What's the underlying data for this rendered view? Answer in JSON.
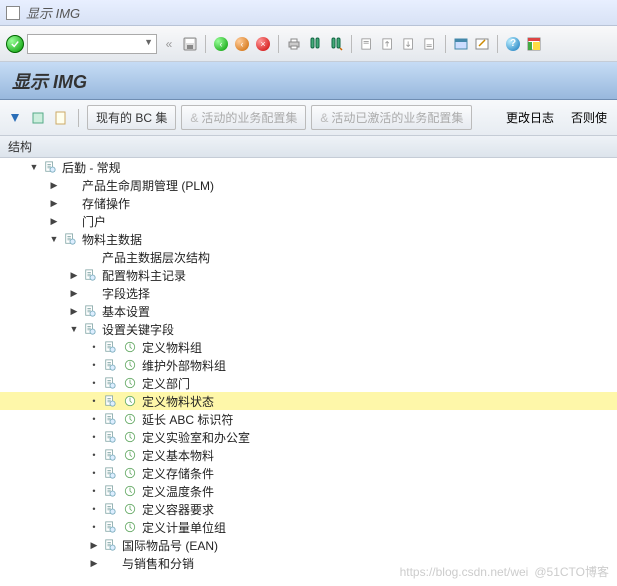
{
  "menu_title": "显示 IMG",
  "page_title": "显示 IMG",
  "tree_header": "结构",
  "watermark_left": "https://blog.csdn.net/wei",
  "watermark_right": "@51CTO博客",
  "toolbar2": {
    "existing_bc": "现有的 BC 集",
    "active_config": "活动的业务配置集",
    "activated_config": "活动已激活的业务配置集",
    "change_log": "更改日志",
    "other_use": "否则使"
  },
  "tree": [
    {
      "indent": 0,
      "toggle": "open",
      "icons": [
        "doc"
      ],
      "label": "后勤 - 常规"
    },
    {
      "indent": 1,
      "toggle": "closed",
      "icons": [],
      "label": "产品生命周期管理 (PLM)"
    },
    {
      "indent": 1,
      "toggle": "closed",
      "icons": [],
      "label": "存储操作"
    },
    {
      "indent": 1,
      "toggle": "closed",
      "icons": [],
      "label": "门户"
    },
    {
      "indent": 1,
      "toggle": "open",
      "icons": [
        "doc"
      ],
      "label": "物料主数据"
    },
    {
      "indent": 2,
      "toggle": "none",
      "icons": [],
      "label": "产品主数据层次结构"
    },
    {
      "indent": 2,
      "toggle": "closed",
      "icons": [
        "doc"
      ],
      "label": "配置物料主记录"
    },
    {
      "indent": 2,
      "toggle": "closed",
      "icons": [],
      "label": "字段选择"
    },
    {
      "indent": 2,
      "toggle": "closed",
      "icons": [
        "doc"
      ],
      "label": "基本设置"
    },
    {
      "indent": 2,
      "toggle": "open",
      "icons": [
        "doc"
      ],
      "label": "设置关键字段"
    },
    {
      "indent": 3,
      "toggle": "dot",
      "icons": [
        "doc",
        "clock"
      ],
      "label": "定义物料组"
    },
    {
      "indent": 3,
      "toggle": "dot",
      "icons": [
        "doc",
        "clock"
      ],
      "label": "维护外部物料组"
    },
    {
      "indent": 3,
      "toggle": "dot",
      "icons": [
        "doc",
        "clock"
      ],
      "label": "定义部门"
    },
    {
      "indent": 3,
      "toggle": "dot",
      "icons": [
        "doc",
        "clock"
      ],
      "label": "定义物料状态",
      "selected": true
    },
    {
      "indent": 3,
      "toggle": "dot",
      "icons": [
        "doc",
        "clock"
      ],
      "label": "延长 ABC 标识符"
    },
    {
      "indent": 3,
      "toggle": "dot",
      "icons": [
        "doc",
        "clock"
      ],
      "label": "定义实验室和办公室"
    },
    {
      "indent": 3,
      "toggle": "dot",
      "icons": [
        "doc",
        "clock"
      ],
      "label": "定义基本物料"
    },
    {
      "indent": 3,
      "toggle": "dot",
      "icons": [
        "doc",
        "clock"
      ],
      "label": "定义存储条件"
    },
    {
      "indent": 3,
      "toggle": "dot",
      "icons": [
        "doc",
        "clock"
      ],
      "label": "定义温度条件"
    },
    {
      "indent": 3,
      "toggle": "dot",
      "icons": [
        "doc",
        "clock"
      ],
      "label": "定义容器要求"
    },
    {
      "indent": 3,
      "toggle": "dot",
      "icons": [
        "doc",
        "clock"
      ],
      "label": "定义计量单位组"
    },
    {
      "indent": 3,
      "toggle": "closed",
      "icons": [
        "doc"
      ],
      "label": "国际物品号 (EAN)"
    },
    {
      "indent": 3,
      "toggle": "closed",
      "icons": [],
      "label": "与销售和分销"
    }
  ]
}
